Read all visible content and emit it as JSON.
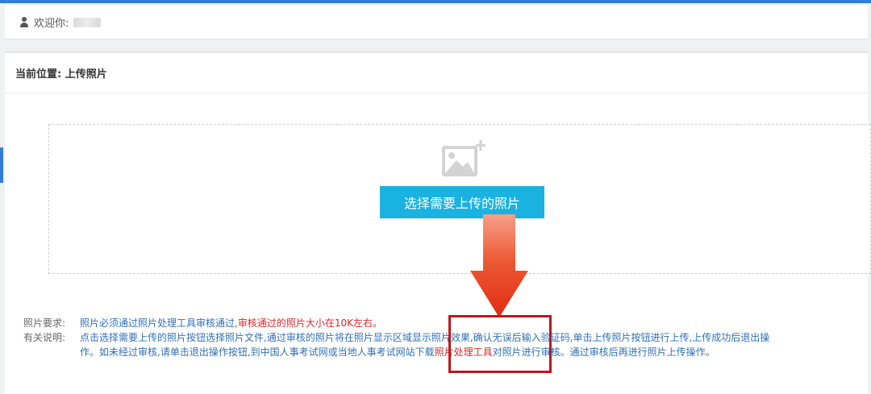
{
  "header": {
    "welcome_label": "欢迎你:"
  },
  "breadcrumb": {
    "text": "当前位置: 上传照片"
  },
  "upload": {
    "button_label": "选择需要上传的照片"
  },
  "notes": {
    "requirement_label": "照片要求:",
    "requirement_text": "照片必须通过照片处理工具审核通过,",
    "requirement_highlight": "审核通过的照片大小在10K左右。",
    "description_label": "有关说明:",
    "description_line1": "点击选择需要上传的照片按钮选择照片文件,通过审核的照片将在照片显示区域显示照片效果,确认无误后输入验证码,单击上传照片按钮进行上传,上传成功后退出操",
    "description_line2_start": "作。如未经过审核,请单击退出操作按钮,到中国人事考试网或当地人事考试网站下载",
    "description_link": "照片处理工具",
    "description_line2_end": "对照片进行审核。通过审核后再进行照片上传操作。"
  },
  "colors": {
    "accent": "#1ab2e0",
    "link_blue": "#2f6fba",
    "warning_red": "#e0262a",
    "arrow_red": "#e8341c",
    "highlight_box": "#c0151c"
  },
  "icons": {
    "user": "user-icon",
    "image_add": "image-add-icon",
    "arrow": "down-arrow-icon"
  }
}
